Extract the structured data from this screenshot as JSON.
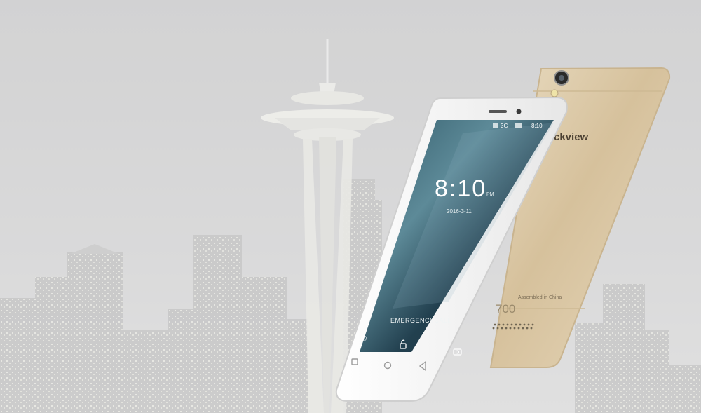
{
  "phone_front": {
    "status": {
      "network": "3G",
      "time": "8:10"
    },
    "lockscreen": {
      "clock": "8:10",
      "ampm": "PM",
      "date": "2016-3-11",
      "emergency_label": "EMERGENCYCALL"
    },
    "icons": [
      "phone-icon",
      "unlock-icon",
      "camera-icon",
      "back-nav-icon",
      "home-nav-icon",
      "recent-nav-icon"
    ]
  },
  "phone_back": {
    "brand": "ckview",
    "assembled": "Assembled in China",
    "model": "700"
  },
  "colors": {
    "gold": "#d9c7a6",
    "front_white": "#f4f4f4",
    "screen": "#1f3a48",
    "sky": "#d6d6d7"
  }
}
